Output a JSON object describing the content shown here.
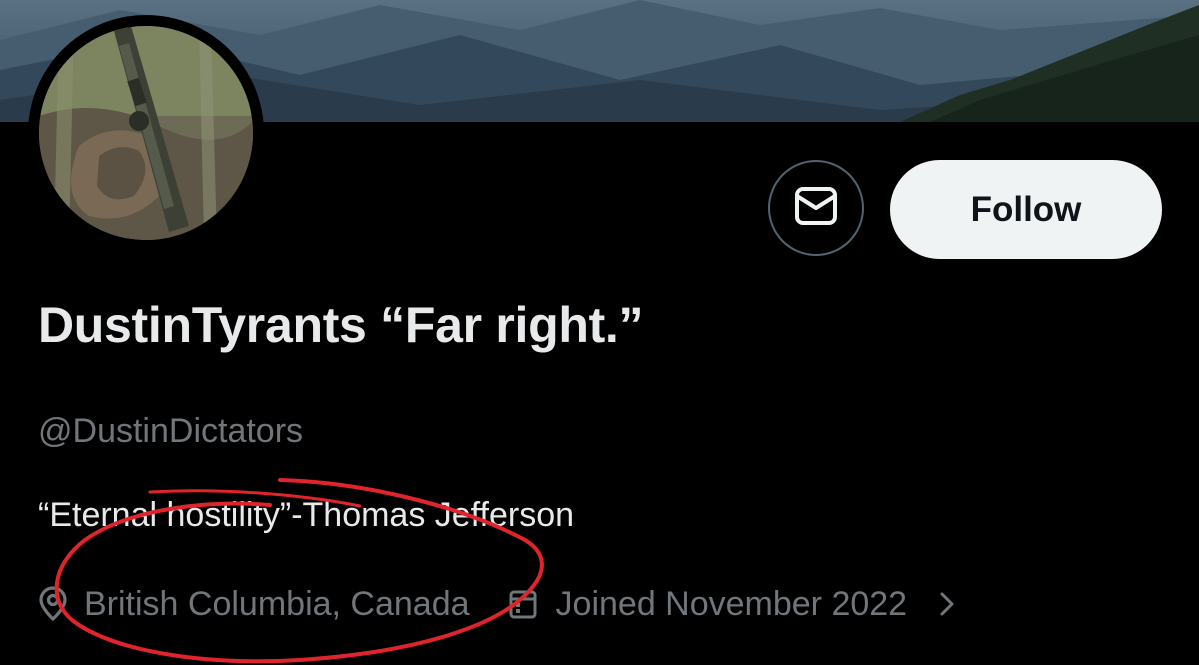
{
  "profile": {
    "display_name": "DustinTyrants “Far right.”",
    "handle": "@DustinDictators",
    "bio": "“Eternal hostility”-Thomas Jefferson",
    "location": "British Columbia, Canada",
    "joined": "Joined November 2022"
  },
  "actions": {
    "follow_label": "Follow",
    "message_icon": "envelope-icon"
  },
  "icons": {
    "location": "location-pin-icon",
    "joined": "calendar-icon",
    "more": "chevron-right-icon"
  },
  "colors": {
    "background": "#000000",
    "primary_text": "#e7e9ea",
    "secondary_text": "#71767b",
    "follow_button_bg": "#eff3f4",
    "annotation_red": "#e0242c"
  }
}
